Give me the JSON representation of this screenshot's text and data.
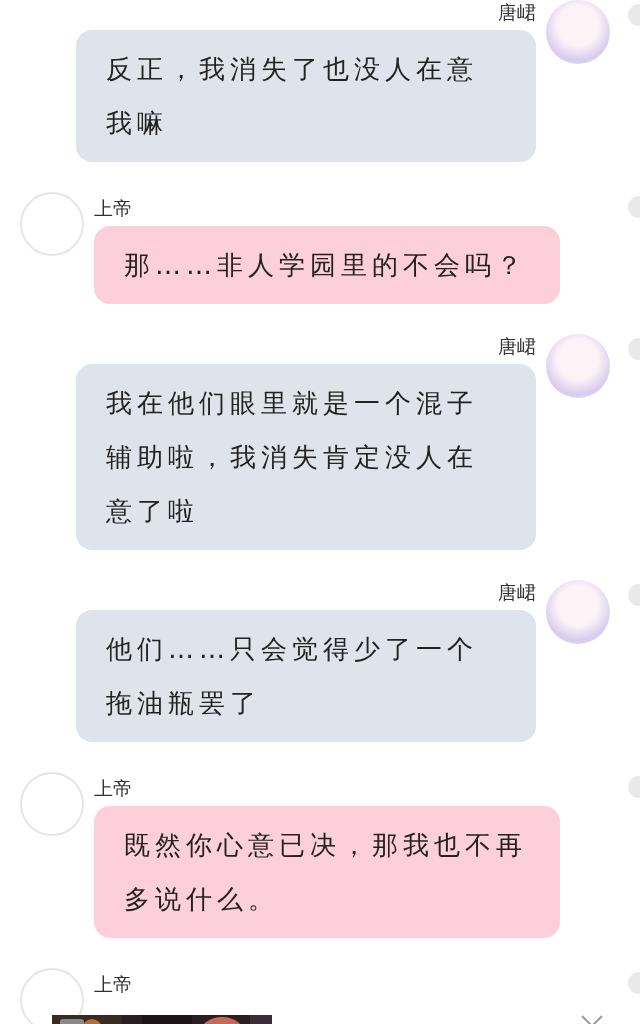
{
  "messages": [
    {
      "kind": "outgoing",
      "name": "唐峮",
      "text": "反正，我消失了也没人在意我嘛"
    },
    {
      "kind": "incoming",
      "name": "上帝",
      "text": "那……非人学园里的不会吗？"
    },
    {
      "kind": "outgoing",
      "name": "唐峮",
      "text": "我在他们眼里就是一个混子辅助啦，我消失肯定没人在意了啦"
    },
    {
      "kind": "outgoing",
      "name": "唐峮",
      "text": "他们……只会觉得少了一个拖油瓶罢了"
    },
    {
      "kind": "incoming",
      "name": "上帝",
      "text": "既然你心意已决，那我也不再多说什么。"
    },
    {
      "kind": "incoming",
      "name": "上帝"
    }
  ]
}
